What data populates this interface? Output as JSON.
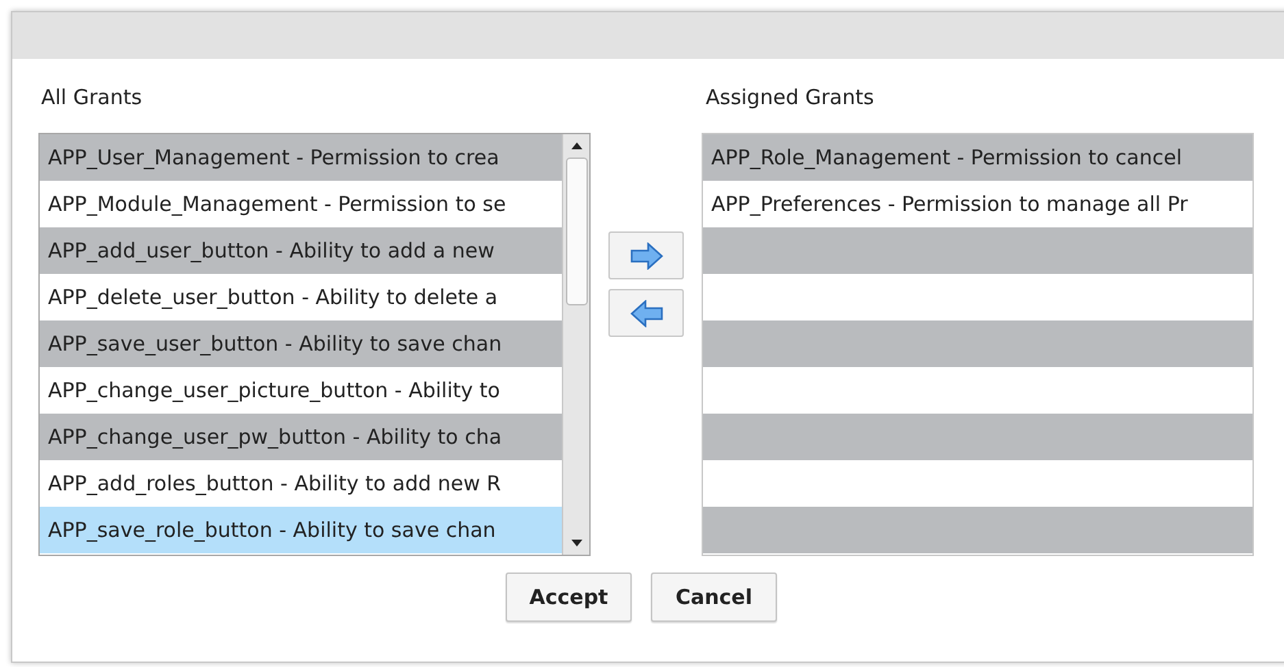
{
  "all_grants": {
    "label": "All Grants",
    "items": [
      {
        "text": "APP_User_Management - Permission to crea",
        "selected": false
      },
      {
        "text": "APP_Module_Management - Permission to se",
        "selected": false
      },
      {
        "text": "APP_add_user_button - Ability to add a new",
        "selected": false
      },
      {
        "text": "APP_delete_user_button - Ability to delete a",
        "selected": false
      },
      {
        "text": "APP_save_user_button - Ability to save chan",
        "selected": false
      },
      {
        "text": "APP_change_user_picture_button - Ability to",
        "selected": false
      },
      {
        "text": "APP_change_user_pw_button - Ability to cha",
        "selected": false
      },
      {
        "text": "APP_add_roles_button - Ability to add new R",
        "selected": false
      },
      {
        "text": "APP_save_role_button - Ability to save chan",
        "selected": true
      }
    ]
  },
  "assigned_grants": {
    "label": "Assigned Grants",
    "items": [
      {
        "text": "APP_Role_Management - Permission to cancel",
        "selected": false
      },
      {
        "text": "APP_Preferences - Permission to manage all Pr",
        "selected": false
      }
    ]
  },
  "buttons": [
    "Accept",
    "Cancel"
  ]
}
